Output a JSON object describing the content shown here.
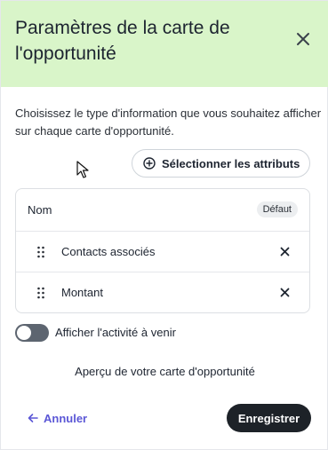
{
  "header": {
    "title": "Paramètres de la carte de l'opportunité"
  },
  "description": "Choisissez le type d'information que vous souhaitez afficher sur chaque carte d'opportunité.",
  "select_attributes_label": "Sélectionner les attributs",
  "fields": {
    "name_row": {
      "label": "Nom",
      "badge": "Défaut"
    },
    "items": [
      {
        "label": "Contacts associés"
      },
      {
        "label": "Montant"
      }
    ]
  },
  "upcoming_activity": {
    "label": "Afficher l'activité à venir",
    "enabled": false
  },
  "preview_title": "Aperçu de votre carte d'opportunité",
  "footer": {
    "cancel_label": "Annuler",
    "save_label": "Enregistrer"
  },
  "colors": {
    "header_bg": "#d9f5c9",
    "accent": "#5b57d6",
    "primary_button": "#1d2228",
    "toggle_off": "#5d6570"
  },
  "icons": {
    "close": "close-icon",
    "add": "plus-circle-icon",
    "drag": "drag-handle-icon",
    "remove": "x-icon",
    "back": "arrow-left-icon"
  }
}
